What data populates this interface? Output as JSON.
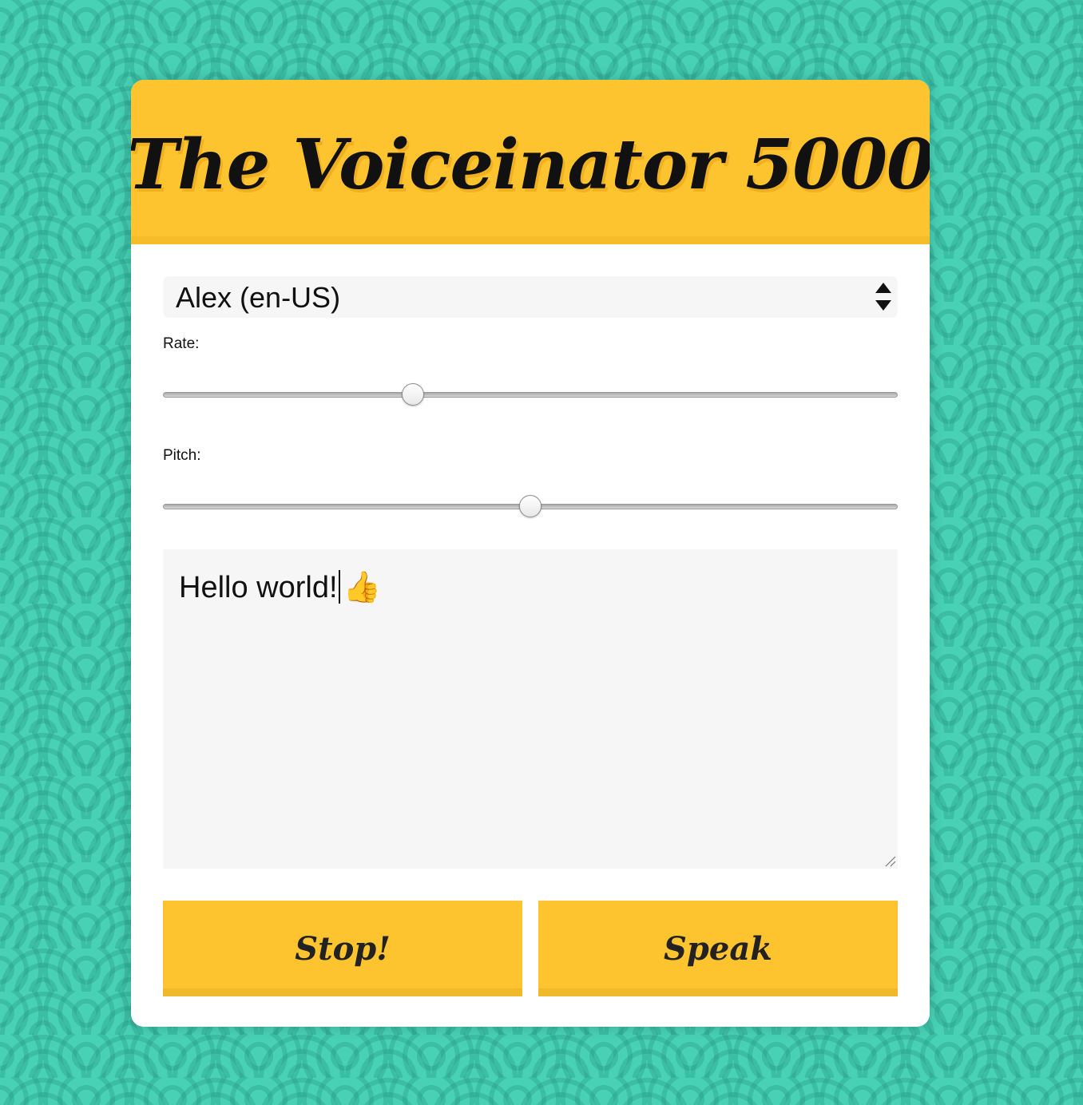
{
  "app": {
    "title": "The Voiceinator 5000"
  },
  "voice_select": {
    "selected": "Alex (en-US)"
  },
  "rate": {
    "label": "Rate:",
    "value": 1,
    "min": 0,
    "max": 3
  },
  "pitch": {
    "label": "Pitch:",
    "value": 1,
    "min": 0,
    "max": 2
  },
  "message": {
    "text": "Hello world!",
    "emoji": "👍"
  },
  "buttons": {
    "stop_label": "Stop!",
    "speak_label": "Speak"
  },
  "colors": {
    "accent": "#fdc42f",
    "background": "#48d1b5",
    "card": "#ffffff"
  }
}
